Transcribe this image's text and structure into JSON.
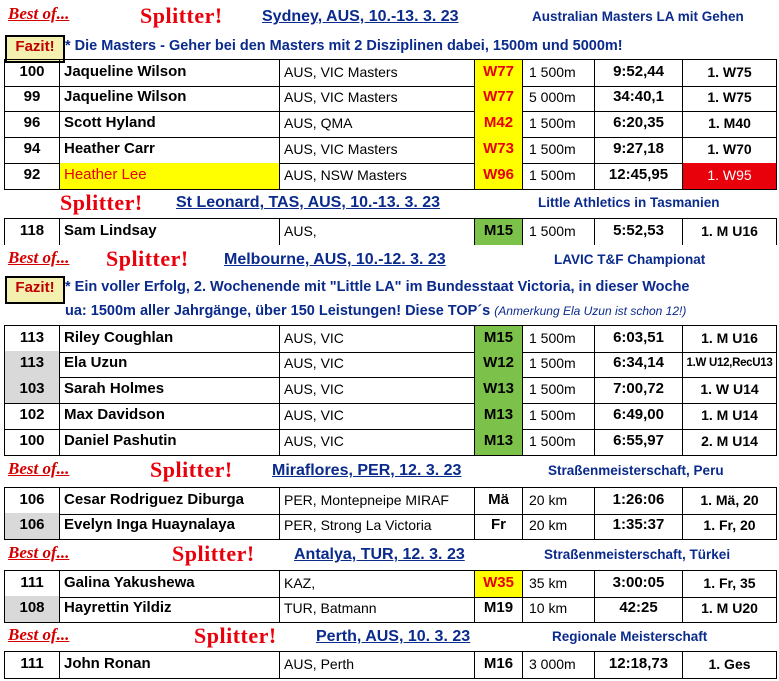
{
  "sections": [
    {
      "best_of": "Best of...",
      "splitter": "Splitter!",
      "venue": "Sydney, AUS, 10.-13. 3. 23",
      "event": "Australian Masters LA mit Gehen",
      "fazit_label": "Fazit!",
      "fazit_lines": [
        "* Die Masters - Geher bei den Masters mit 2 Disziplinen dabei, 1500m und 5000m!"
      ],
      "rows": [
        {
          "score": "100",
          "name": "Jaqueline Wilson",
          "club": "AUS, VIC Masters",
          "cls": "W77",
          "dist": "1 500m",
          "time": "9:52,44",
          "place": "1. W75"
        },
        {
          "score": "99",
          "name": "Jaqueline Wilson",
          "club": "AUS, VIC Masters",
          "cls": "W77",
          "dist": "5 000m",
          "time": "34:40,1",
          "place": "1. W75"
        },
        {
          "score": "96",
          "name": "Scott Hyland",
          "club": "AUS, QMA",
          "cls": "M42",
          "dist": "1 500m",
          "time": "6:20,35",
          "place": "1. M40"
        },
        {
          "score": "94",
          "name": "Heather Carr",
          "club": "AUS, VIC Masters",
          "cls": "W73",
          "dist": "1 500m",
          "time": "9:27,18",
          "place": "1. W70"
        },
        {
          "score": "92",
          "name": "Heather Lee",
          "club": "AUS, NSW Masters",
          "cls": "W96",
          "dist": "1 500m",
          "time": "12:45,95",
          "place": "1. W95"
        }
      ]
    },
    {
      "splitter": "Splitter!",
      "venue": "St Leonard, TAS, AUS, 10.-13. 3. 23",
      "event": "Little Athletics in Tasmanien",
      "rows": [
        {
          "score": "118",
          "name": "Sam Lindsay",
          "club": "AUS,",
          "cls": "M15",
          "dist": "1 500m",
          "time": "5:52,53",
          "place": "1. M U16"
        }
      ]
    },
    {
      "best_of": "Best of...",
      "splitter": "Splitter!",
      "venue": "Melbourne, AUS, 10.-12. 3. 23",
      "event": "LAVIC T&F Championat",
      "fazit_label": "Fazit!",
      "fazit_lines": [
        "* Ein voller Erfolg, 2. Wochenende mit  \"Little LA\" im Bundesstaat Victoria, in dieser Woche",
        "ua: 1500m aller Jahrgänge, über 150 Leistungen! Diese TOP´s"
      ],
      "fazit_note": "(Anmerkung Ela Uzun ist schon 12!)",
      "rows": [
        {
          "score": "113",
          "name": "Riley Coughlan",
          "club": "AUS, VIC",
          "cls": "M15",
          "dist": "1 500m",
          "time": "6:03,51",
          "place": "1. M U16"
        },
        {
          "score": "113",
          "name": "Ela Uzun",
          "club": "AUS, VIC",
          "cls": "W12",
          "dist": "1 500m",
          "time": "6:34,14",
          "place": "1.W U12,RecU13"
        },
        {
          "score": "103",
          "name": "Sarah Holmes",
          "club": "AUS, VIC",
          "cls": "W13",
          "dist": "1 500m",
          "time": "7:00,72",
          "place": "1. W U14"
        },
        {
          "score": "102",
          "name": "Max Davidson",
          "club": "AUS, VIC",
          "cls": "M13",
          "dist": "1 500m",
          "time": "6:49,00",
          "place": "1. M U14"
        },
        {
          "score": "100",
          "name": "Daniel Pashutin",
          "club": "AUS, VIC",
          "cls": "M13",
          "dist": "1 500m",
          "time": "6:55,97",
          "place": "2. M U14"
        }
      ]
    },
    {
      "best_of": "Best of...",
      "splitter": "Splitter!",
      "venue": "Miraflores, PER, 12. 3. 23",
      "event": "Straßenmeisterschaft, Peru",
      "rows": [
        {
          "score": "106",
          "name": "Cesar Rodriguez Diburga",
          "club": "PER, Montepneipe MIRAF",
          "cls": "Mä",
          "dist": "20 km",
          "time": "1:26:06",
          "place": "1. Mä, 20"
        },
        {
          "score": "106",
          "name": "Evelyn Inga Huaynalaya",
          "club": "PER, Strong La Victoria",
          "cls": "Fr",
          "dist": "20 km",
          "time": "1:35:37",
          "place": "1. Fr, 20"
        }
      ]
    },
    {
      "best_of": "Best of...",
      "splitter": "Splitter!",
      "venue": "Antalya, TUR, 12. 3. 23",
      "event": "Straßenmeisterschaft, Türkei",
      "rows": [
        {
          "score": "111",
          "name": "Galina Yakushewa",
          "club": "KAZ,",
          "cls": "W35",
          "dist": "35 km",
          "time": "3:00:05",
          "place": "1. Fr, 35"
        },
        {
          "score": "108",
          "name": "Hayrettin Yildiz",
          "club": "TUR, Batmann",
          "cls": "M19",
          "dist": "10 km",
          "time": "42:25",
          "place": "1. M U20"
        }
      ]
    },
    {
      "best_of": "Best of...",
      "splitter": "Splitter!",
      "venue": "Perth, AUS, 10. 3. 23",
      "event": "Regionale Meisterschaft",
      "rows": [
        {
          "score": "111",
          "name": "John Ronan",
          "club": "AUS, Perth",
          "cls": "M16",
          "dist": "3 000m",
          "time": "12:18,73",
          "place": "1. Ges"
        }
      ]
    }
  ],
  "colors": {
    "red": "#e8000b",
    "blue": "#0a2a8c",
    "yellow": "#ffff00",
    "green": "#7cc24a",
    "gray": "#d9d9d9"
  }
}
